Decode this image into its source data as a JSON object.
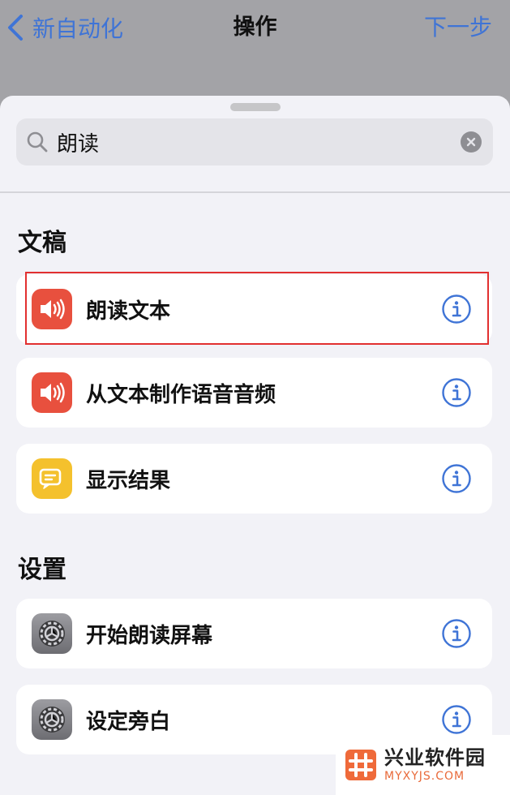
{
  "navbar": {
    "back_label": "新自动化",
    "title": "操作",
    "next_label": "下一步"
  },
  "search": {
    "value": "朗读",
    "placeholder": ""
  },
  "sections": [
    {
      "header": "文稿",
      "items": [
        {
          "label": "朗读文本",
          "icon": "speaker-icon",
          "icon_color": "#e8503e"
        },
        {
          "label": "从文本制作语音音频",
          "icon": "speaker-icon",
          "icon_color": "#e8503e"
        },
        {
          "label": "显示结果",
          "icon": "result-bubble-icon",
          "icon_color": "#f4c12d"
        }
      ]
    },
    {
      "header": "设置",
      "items": [
        {
          "label": "开始朗读屏幕",
          "icon": "settings-gear-icon",
          "icon_color": "#8e8e93"
        },
        {
          "label": "设定旁白",
          "icon": "settings-gear-icon",
          "icon_color": "#8e8e93"
        }
      ]
    }
  ],
  "colors": {
    "accent": "#3f74d6",
    "highlight_box": "#e23030"
  },
  "watermark": {
    "name": "兴业软件园",
    "url": "MYXYJS.COM"
  }
}
